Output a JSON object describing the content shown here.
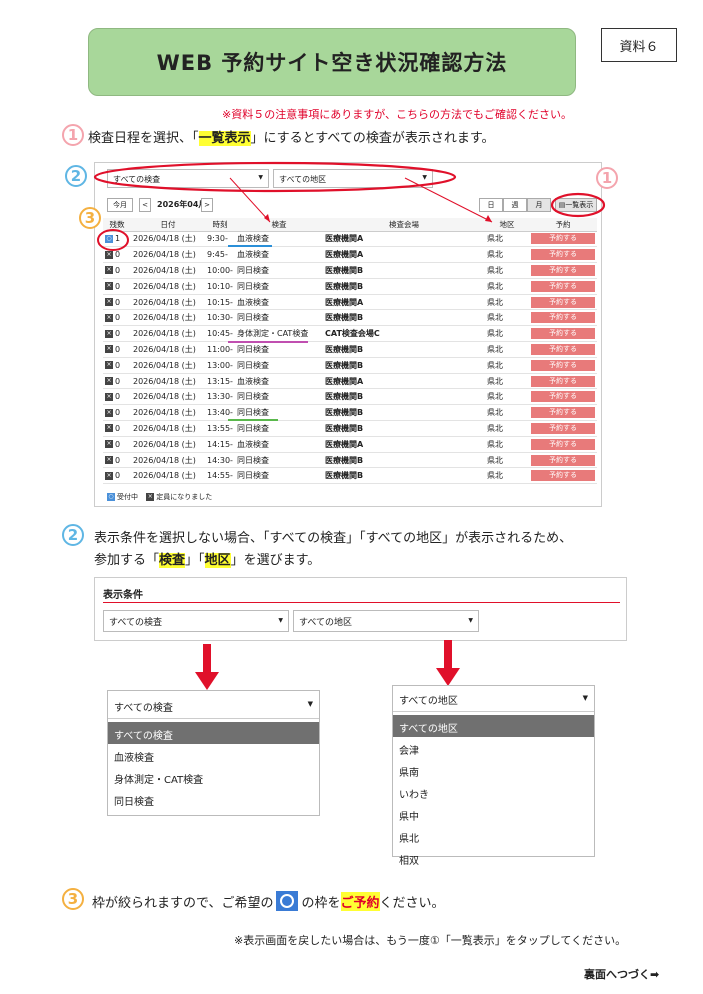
{
  "title": "WEB 予約サイト空き状況確認方法",
  "doc_label": "資料６",
  "note_top": "※資料５の注意事項にありますが、こちらの方法でもご確認ください。",
  "step1": {
    "num": "1",
    "pre": "検査日程を選択、「",
    "highlight": "一覧表示",
    "post": "」にするとすべての検査が表示されます。"
  },
  "screen": {
    "filter_exam": "すべての検査",
    "filter_area": "すべての地区",
    "today": "今月",
    "prev": "<",
    "month": "2026年04月",
    "next": ">",
    "view_day": "日",
    "view_week": "週",
    "view_month": "月",
    "view_list": "一覧表示",
    "headers": [
      "残数",
      "日付",
      "時刻",
      "検査",
      "検査会場",
      "地区",
      "予約"
    ],
    "rows": [
      {
        "mark": "○",
        "count": "1",
        "date": "2026/04/18 (土)",
        "time": "9:30-",
        "exam": "血液検査",
        "venue": "医療機関A",
        "area": "県北",
        "btn": "予約する"
      },
      {
        "mark": "×",
        "count": "0",
        "date": "2026/04/18 (土)",
        "time": "9:45-",
        "exam": "血液検査",
        "venue": "医療機関A",
        "area": "県北",
        "btn": "予約する"
      },
      {
        "mark": "×",
        "count": "0",
        "date": "2026/04/18 (土)",
        "time": "10:00-",
        "exam": "同日検査",
        "venue": "医療機関B",
        "area": "県北",
        "btn": "予約する"
      },
      {
        "mark": "×",
        "count": "0",
        "date": "2026/04/18 (土)",
        "time": "10:10-",
        "exam": "同日検査",
        "venue": "医療機関B",
        "area": "県北",
        "btn": "予約する"
      },
      {
        "mark": "×",
        "count": "0",
        "date": "2026/04/18 (土)",
        "time": "10:15-",
        "exam": "血液検査",
        "venue": "医療機関A",
        "area": "県北",
        "btn": "予約する"
      },
      {
        "mark": "×",
        "count": "0",
        "date": "2026/04/18 (土)",
        "time": "10:30-",
        "exam": "同日検査",
        "venue": "医療機関B",
        "area": "県北",
        "btn": "予約する"
      },
      {
        "mark": "×",
        "count": "0",
        "date": "2026/04/18 (土)",
        "time": "10:45-",
        "exam": "身体測定・CAT検査",
        "venue": "CAT検査会場C",
        "area": "県北",
        "btn": "予約する"
      },
      {
        "mark": "×",
        "count": "0",
        "date": "2026/04/18 (土)",
        "time": "11:00-",
        "exam": "同日検査",
        "venue": "医療機関B",
        "area": "県北",
        "btn": "予約する"
      },
      {
        "mark": "×",
        "count": "0",
        "date": "2026/04/18 (土)",
        "time": "13:00-",
        "exam": "同日検査",
        "venue": "医療機関B",
        "area": "県北",
        "btn": "予約する"
      },
      {
        "mark": "×",
        "count": "0",
        "date": "2026/04/18 (土)",
        "time": "13:15-",
        "exam": "血液検査",
        "venue": "医療機関A",
        "area": "県北",
        "btn": "予約する"
      },
      {
        "mark": "×",
        "count": "0",
        "date": "2026/04/18 (土)",
        "time": "13:30-",
        "exam": "同日検査",
        "venue": "医療機関B",
        "area": "県北",
        "btn": "予約する"
      },
      {
        "mark": "×",
        "count": "0",
        "date": "2026/04/18 (土)",
        "time": "13:40-",
        "exam": "同日検査",
        "venue": "医療機関B",
        "area": "県北",
        "btn": "予約する"
      },
      {
        "mark": "×",
        "count": "0",
        "date": "2026/04/18 (土)",
        "time": "13:55-",
        "exam": "同日検査",
        "venue": "医療機関B",
        "area": "県北",
        "btn": "予約する"
      },
      {
        "mark": "×",
        "count": "0",
        "date": "2026/04/18 (土)",
        "time": "14:15-",
        "exam": "血液検査",
        "venue": "医療機関A",
        "area": "県北",
        "btn": "予約する"
      },
      {
        "mark": "×",
        "count": "0",
        "date": "2026/04/18 (土)",
        "time": "14:30-",
        "exam": "同日検査",
        "venue": "医療機関B",
        "area": "県北",
        "btn": "予約する"
      },
      {
        "mark": "×",
        "count": "0",
        "date": "2026/04/18 (土)",
        "time": "14:55-",
        "exam": "同日検査",
        "venue": "医療機関B",
        "area": "県北",
        "btn": "予約する"
      }
    ],
    "legend_open": "受付中",
    "legend_full": "定員になりました"
  },
  "step2": {
    "num": "2",
    "line1": "表示条件を選択しない場合、「すべての検査」「すべての地区」が表示されるため、",
    "pre": "参加する「",
    "hl1": "検査",
    "mid": "」「",
    "hl2": "地区",
    "post": "」を選びます。"
  },
  "conditions": {
    "label": "表示条件",
    "exam": "すべての検査",
    "area": "すべての地区",
    "exam_options": [
      "すべての検査",
      "血液検査",
      "身体測定・CAT検査",
      "同日検査"
    ],
    "area_options": [
      "すべての地区",
      "会津",
      "県南",
      "いわき",
      "県中",
      "県北",
      "相双"
    ]
  },
  "step3": {
    "num": "3",
    "pre": "枠が絞られますので、ご希望の",
    "mid": "の枠を",
    "hl": "ご予約",
    "post": "ください。"
  },
  "note_bottom": "※表示画面を戻したい場合は、もう一度①「一覧表示」をタップしてください。",
  "next_page": "裏面へつづく➡",
  "colors": {
    "title_bg": "#a8d79a",
    "accent_red": "#e0002a",
    "reserve_btn": "#e87a7a",
    "open_mark": "#4a90d9"
  }
}
